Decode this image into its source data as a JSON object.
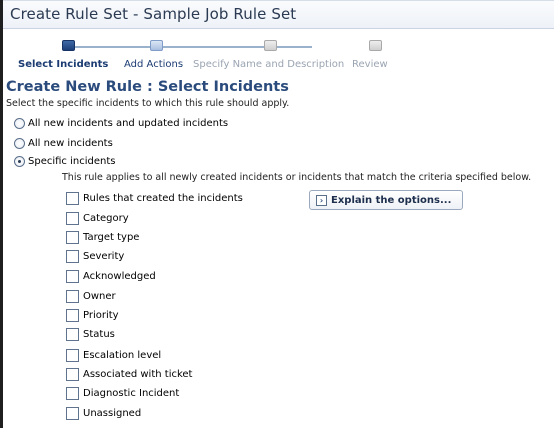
{
  "title": "Create Rule Set - Sample Job Rule Set",
  "train": {
    "steps": [
      {
        "label": "Select Incidents",
        "state": "active"
      },
      {
        "label": "Add Actions",
        "state": "next"
      },
      {
        "label": "Specify Name and Description",
        "state": "disabled"
      },
      {
        "label": "Review",
        "state": "disabled"
      }
    ]
  },
  "heading": "Create New Rule : Select Incidents",
  "instruction": "Select the specific incidents to which this rule should apply.",
  "options": [
    {
      "label": "All new incidents and updated incidents",
      "selected": false
    },
    {
      "label": "All new incidents",
      "selected": false
    },
    {
      "label": "Specific incidents",
      "selected": true
    }
  ],
  "note": "This rule applies to all newly created incidents or incidents that match the criteria specified below.",
  "criteria": [
    "Rules that created the incidents",
    "Category",
    "Target type",
    "Severity",
    "Acknowledged",
    "Owner",
    "Priority",
    "Status",
    "Escalation level",
    "Associated with ticket",
    "Diagnostic Incident",
    "Unassigned"
  ],
  "explain_button": {
    "icon": "chevron-right-icon",
    "label": "Explain the options..."
  }
}
